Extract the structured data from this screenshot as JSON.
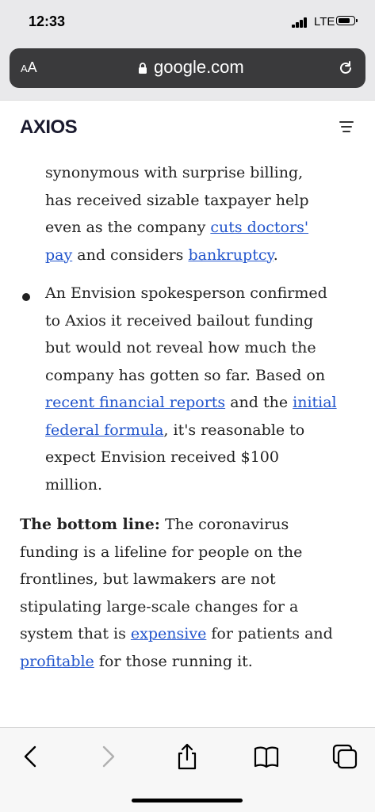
{
  "status_bar": {
    "time": "12:33",
    "network": "LTE"
  },
  "address_bar": {
    "text_size_label": "AA",
    "url": "google.com"
  },
  "site": {
    "logo": "AXIOS"
  },
  "article": {
    "p1_l1": "synonymous with surprise billing,",
    "p1_l2": "has received sizable taxpayer help",
    "p1_l3_pre": "even as the company ",
    "p1_link_cuts": "cuts doctors'",
    "p1_link_pay": "pay",
    "p1_l4_mid": " and considers ",
    "p1_link_bankruptcy": "bankruptcy",
    "p1_l4_end": ".",
    "b2_l1": "An Envision spokesperson confirmed",
    "b2_l2": "to Axios it received bailout funding",
    "b2_l3": "but would not reveal how much the",
    "b2_l4": "company has gotten so far. Based on",
    "b2_link_reports": "recent financial reports",
    "b2_l5_mid": " and the ",
    "b2_link_initial": "initial",
    "b2_link_formula": "federal formula",
    "b2_l6_end": ", it's reasonable to",
    "b2_l7": "expect Envision received $100",
    "b2_l8": "million.",
    "bl_lead": "The bottom line:",
    "bl_l1_rest": " The coronavirus",
    "bl_l2": "funding is a lifeline for people on the",
    "bl_l3": "frontlines, but lawmakers are not",
    "bl_l4": "stipulating large-scale changes for a",
    "bl_l5_pre": "system that is ",
    "bl_link_expensive": "expensive",
    "bl_l5_post": " for patients and",
    "bl_link_profitable": "profitable",
    "bl_l6_post": " for those running it."
  },
  "colors": {
    "link": "#2255cc",
    "chrome": "#3a3a3c",
    "toolbar_icons": "#000000"
  }
}
